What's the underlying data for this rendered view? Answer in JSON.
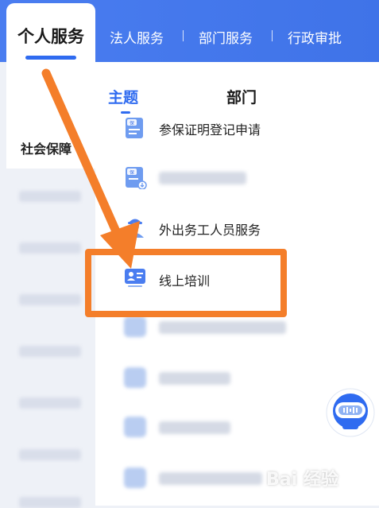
{
  "tabs": {
    "active": "个人服务",
    "items": [
      "法人服务",
      "部门服务",
      "行政审批"
    ]
  },
  "sidebar": {
    "active_label": "社会保障"
  },
  "panel": {
    "sub_tabs": [
      "主题",
      "部门"
    ],
    "items": [
      {
        "label": "参保证明登记申请",
        "icon": "insurance-doc-icon"
      },
      {
        "label": "",
        "icon": "insurance-doc-download-icon"
      },
      {
        "label": "外出务工人员服务",
        "icon": "worker-icon"
      },
      {
        "label": "线上培训",
        "icon": "online-training-icon"
      }
    ]
  },
  "watermark": "Bai 经验",
  "colors": {
    "brand": "#3f73e8",
    "accent_blue": "#2f6bf0",
    "highlight": "#f47e2a"
  }
}
